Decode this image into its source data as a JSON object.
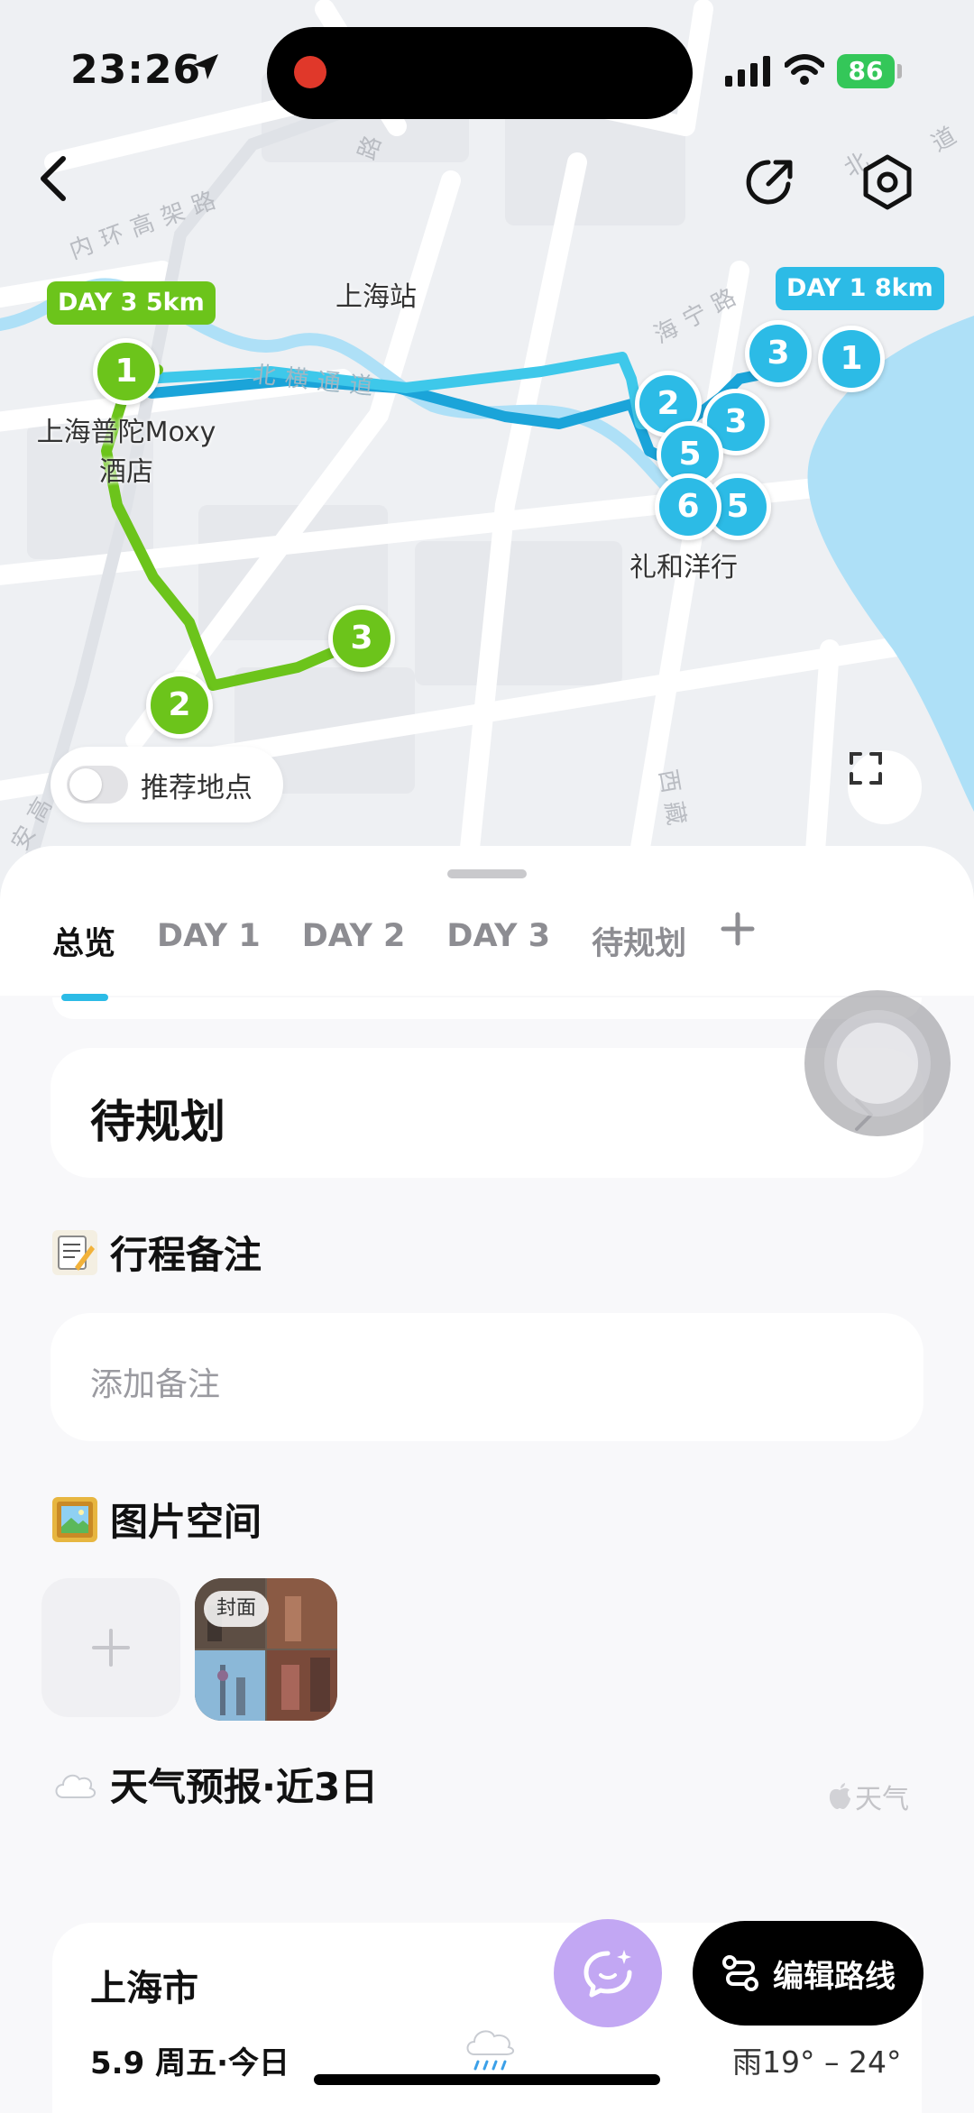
{
  "status": {
    "time": "23:26",
    "battery": "86"
  },
  "map": {
    "labels": {
      "station": "上海站",
      "hotel": "上海普陀Moxy酒店",
      "hotel_line1": "上海普陀Moxy",
      "hotel_line2": "酒店",
      "lihe": "礼和洋行"
    },
    "road_names": {
      "inner_ring": "内环高架路",
      "haining": "海宁路",
      "beiheng": "北横通道",
      "xizang": "西藏",
      "an_gao": "安高",
      "lu": "路",
      "bei": "北",
      "dao": "道"
    },
    "day_tags": {
      "day3": "DAY 3 5km",
      "day1": "DAY 1 8km"
    },
    "pins": {
      "green": [
        "1",
        "2",
        "3"
      ],
      "blue": [
        "3",
        "1",
        "2",
        "3",
        "5",
        "6",
        "5"
      ]
    },
    "recommend_label": "推荐地点",
    "colors": {
      "day3_route": "#6cc41b",
      "day1_route": "#2cbbe6",
      "day1_route_dark": "#1ba4d9",
      "river": "#aee0f7"
    },
    "icons": {
      "back": "back-arrow-icon",
      "share": "share-icon",
      "settings": "settings-hexagon-icon",
      "fullscreen": "fullscreen-icon"
    }
  },
  "tabs": [
    {
      "label": "总览",
      "active": true
    },
    {
      "label": "DAY 1",
      "active": false
    },
    {
      "label": "DAY 2",
      "active": false
    },
    {
      "label": "DAY 3",
      "active": false
    },
    {
      "label": "待规划",
      "active": false
    }
  ],
  "unplanned": {
    "title": "待规划"
  },
  "notes": {
    "emoji": "📝",
    "title": "行程备注",
    "placeholder": "添加备注"
  },
  "photos": {
    "emoji": "🖼",
    "title": "图片空间",
    "cover_badge": "封面"
  },
  "weather": {
    "emoji": "☁️",
    "title": "天气预报·近3日",
    "brand": "天气",
    "city": "上海市",
    "date": "5.9 周五·今日",
    "temp": "雨19° – 24°",
    "icon": "rain-cloud-icon"
  },
  "actions": {
    "edit_route": "编辑路线"
  }
}
